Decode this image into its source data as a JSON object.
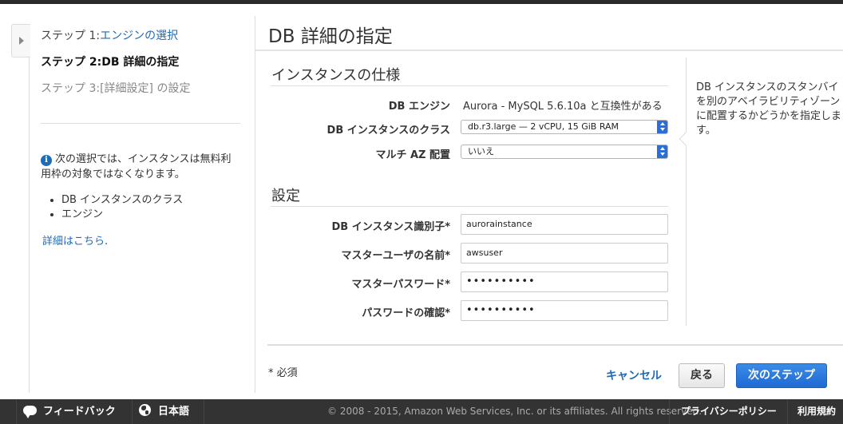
{
  "sidebar": {
    "step1_prefix": "ステップ 1:",
    "step1_link": "エンジンの選択",
    "step2": "ステップ 2:DB 詳細の指定",
    "step3": "ステップ 3:[詳細設定] の設定",
    "info_text": "次の選択では、インスタンスは無料利用枠の対象ではなくなります。",
    "info_items": [
      "DB インスタンスのクラス",
      "エンジン"
    ],
    "more_link": "詳細はこちら",
    "more_suffix": "."
  },
  "main": {
    "title": "DB 詳細の指定",
    "instance_spec": {
      "heading": "インスタンスの仕様",
      "engine_label": "DB エンジン",
      "engine_value": "Aurora - MySQL 5.6.10a と互換性がある",
      "class_label": "DB インスタンスのクラス",
      "class_value": "db.r3.large — 2 vCPU, 15 GiB RAM",
      "multiaz_label": "マルチ AZ 配置",
      "multiaz_value": "いいえ"
    },
    "settings": {
      "heading": "設定",
      "identifier_label": "DB インスタンス識別子*",
      "identifier_value": "aurorainstance",
      "username_label": "マスターユーザの名前*",
      "username_value": "awsuser",
      "password_label": "マスターパスワード*",
      "password_value": "••••••••••",
      "confirm_label": "パスワードの確認*",
      "confirm_value": "••••••••••"
    },
    "help_text": [
      "DB インスタンスのスタンバイ",
      "を別のアベイラビリティゾーン",
      "に配置するかどうかを指定しま",
      "す。"
    ],
    "required_note": "* 必須",
    "cancel": "キャンセル",
    "back": "戻る",
    "next": "次のステップ"
  },
  "footer": {
    "feedback": "フィードバック",
    "language": "日本語",
    "copyright": "© 2008 - 2015, Amazon Web Services, Inc. or its affiliates. All rights reserved.",
    "privacy": "プライバシーポリシー",
    "terms": "利用規約"
  },
  "colors": {
    "link": "#1e6bb8",
    "primary_button": "#1f6ad3",
    "footer_bg": "#333333"
  },
  "icons": [
    "chevron-right-icon",
    "info-icon",
    "chat-icon",
    "globe-icon"
  ]
}
